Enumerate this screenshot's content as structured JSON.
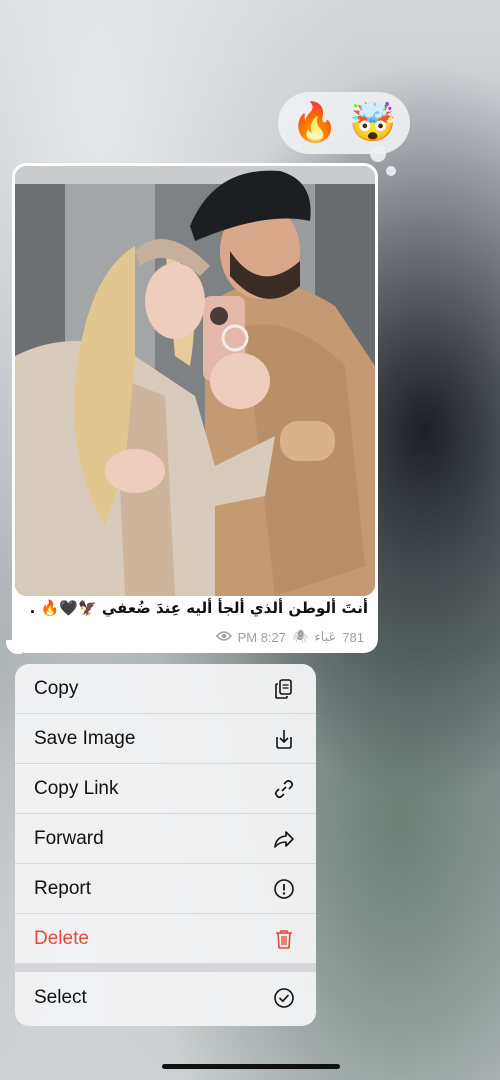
{
  "reactions": [
    "🔥",
    "🤯"
  ],
  "message": {
    "caption": "أنتَ ألوطن ألذي ألجأ أليه عِندَ ضُعفي 🦅🖤🔥 .",
    "time": "8:27 PM",
    "views": "781",
    "author": "عَباء",
    "spider": "🕷"
  },
  "menu": {
    "items": [
      {
        "label": "Copy",
        "icon": "copy-icon"
      },
      {
        "label": "Save Image",
        "icon": "save-image-icon"
      },
      {
        "label": "Copy Link",
        "icon": "link-icon"
      },
      {
        "label": "Forward",
        "icon": "forward-icon"
      },
      {
        "label": "Report",
        "icon": "report-icon"
      },
      {
        "label": "Delete",
        "icon": "trash-icon",
        "color": "#e5483c"
      },
      {
        "label": "Select",
        "icon": "select-check-icon"
      }
    ]
  }
}
